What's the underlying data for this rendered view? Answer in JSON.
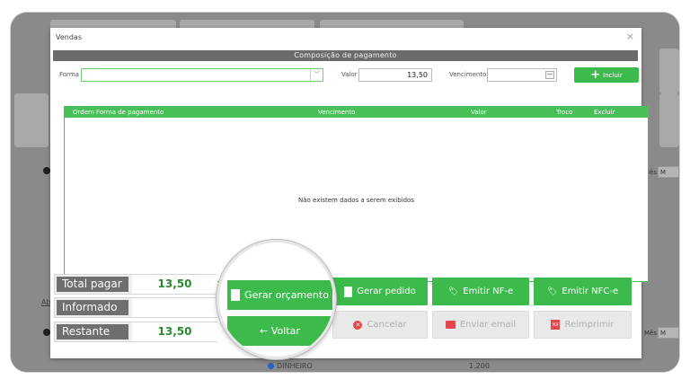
{
  "background": {
    "mes_label": "Mês",
    "mes_value_right": "M",
    "mes_value_left": "Mês",
    "legend_dinheiro": "DINHEIRO",
    "axis_value": "1.200",
    "left_link": "Ab"
  },
  "dialog": {
    "title": "Vendas",
    "close_glyph": "×",
    "section_title": "Composição de pagamento",
    "form": {
      "forma_label": "Forma",
      "forma_value": "",
      "valor_label": "Valor",
      "valor_value": "13,50",
      "vencimento_label": "Vencimento",
      "vencimento_value": "",
      "incluir_label": "Incluir"
    },
    "grid": {
      "headers": [
        "Ordem Forma de pagamento",
        "Vencimento",
        "Valor",
        "Troco",
        "Excluir"
      ],
      "empty_message": "Não existem dados a serem exibidos"
    },
    "totals": {
      "total_pagar_label": "Total pagar",
      "total_pagar_value": "13,50",
      "informado_label": "Informado",
      "informado_value": "",
      "restante_label": "Restante",
      "restante_value": "13,50"
    },
    "actions": {
      "gerar_orcamento": "Gerar orçamento",
      "gerar_pedido": "Gerar pedido",
      "emitir_nfe": "Emitir NF-e",
      "emitir_nfce": "Emitir NFC-e",
      "voltar": "← Voltar",
      "cancelar": "Cancelar",
      "enviar_email": "Enviar email",
      "reimprimir": "Reimprimir"
    }
  },
  "colors": {
    "accent_green": "#3cba4b",
    "header_gray": "#6b6b6b",
    "danger_red": "#e0484e"
  }
}
